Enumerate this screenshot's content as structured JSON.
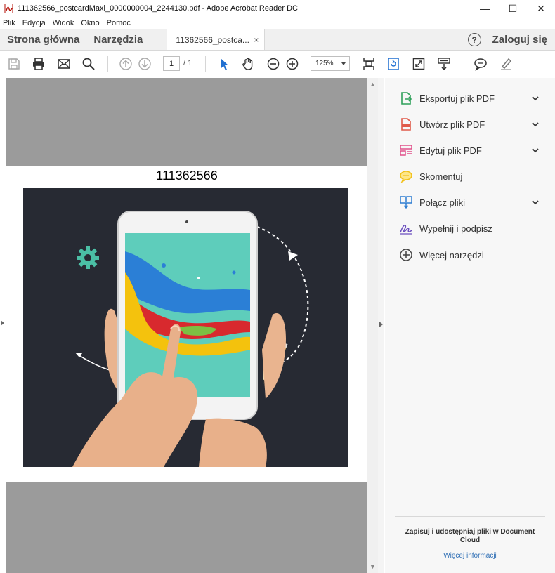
{
  "window": {
    "title": "111362566_postcardMaxi_0000000004_2244130.pdf - Adobe Acrobat Reader DC",
    "minimize_glyph": "—",
    "maximize_glyph": "☐",
    "close_glyph": "✕"
  },
  "menu": [
    "Plik",
    "Edycja",
    "Widok",
    "Okno",
    "Pomoc"
  ],
  "tabs": {
    "home": "Strona główna",
    "tools": "Narzędzia",
    "document": "11362566_postca...",
    "document_close": "×"
  },
  "header": {
    "help": "?",
    "login": "Zaloguj się"
  },
  "toolbar": {
    "page_current": "1",
    "page_total": "/ 1",
    "zoom": "125%"
  },
  "document": {
    "page_heading": "111362566",
    "photo_label": "tablet-with-paint-splash-photo"
  },
  "tools_panel": {
    "items": [
      {
        "label": "Eksportuj plik PDF",
        "icon": "export-pdf-icon",
        "color": "#2fa05a",
        "expandable": true
      },
      {
        "label": "Utwórz plik PDF",
        "icon": "create-pdf-icon",
        "color": "#e05a4a",
        "expandable": true
      },
      {
        "label": "Edytuj plik PDF",
        "icon": "edit-pdf-icon",
        "color": "#e0508a",
        "expandable": true
      },
      {
        "label": "Skomentuj",
        "icon": "comment-icon",
        "color": "#f2c11a",
        "expandable": false
      },
      {
        "label": "Połącz pliki",
        "icon": "combine-files-icon",
        "color": "#2d7dd2",
        "expandable": true
      },
      {
        "label": "Wypełnij i podpisz",
        "icon": "fill-sign-icon",
        "color": "#6b4fbf",
        "expandable": false
      },
      {
        "label": "Więcej narzędzi",
        "icon": "more-tools-icon",
        "color": "#444444",
        "expandable": false
      }
    ],
    "footer_text": "Zapisuj i udostępniaj pliki w Document Cloud",
    "footer_link": "Więcej informacji"
  }
}
